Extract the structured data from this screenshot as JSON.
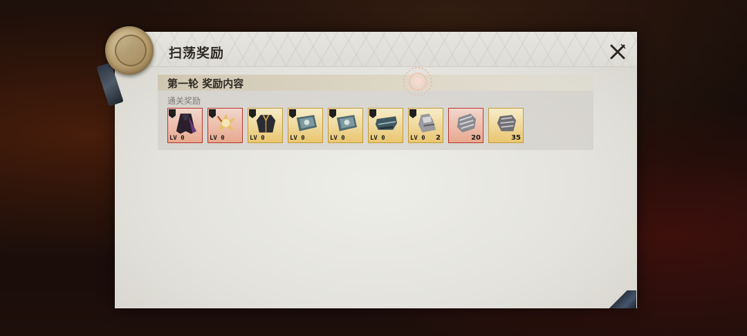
{
  "dialog": {
    "title": "扫荡奖励",
    "close_icon": "close-x-icon"
  },
  "round": {
    "title": "第一轮 奖励内容",
    "section_label": "通关奖励"
  },
  "rewards": [
    {
      "name": "dark-feather-cloak",
      "rarity": "red",
      "level_text": "LV 0",
      "qty": ""
    },
    {
      "name": "flame-crest-ornament",
      "rarity": "red",
      "level_text": "LV 0",
      "qty": ""
    },
    {
      "name": "dark-coat",
      "rarity": "gold",
      "level_text": "LV 0",
      "qty": ""
    },
    {
      "name": "teal-scroll",
      "rarity": "gold",
      "level_text": "LV 0",
      "qty": ""
    },
    {
      "name": "teal-scroll",
      "rarity": "gold",
      "level_text": "LV 0",
      "qty": ""
    },
    {
      "name": "teal-boots",
      "rarity": "gold",
      "level_text": "LV 0",
      "qty": ""
    },
    {
      "name": "silver-gauntlet",
      "rarity": "gold",
      "level_text": "LV 0",
      "qty": "2"
    },
    {
      "name": "metal-bracer",
      "rarity": "red",
      "level_text": "",
      "qty": "20"
    },
    {
      "name": "metal-bracer",
      "rarity": "gold",
      "level_text": "",
      "qty": "35"
    }
  ],
  "colors": {
    "red_frame": "#b7332b",
    "gold_frame": "#c29a39",
    "panel_bg": "#e6e5df"
  }
}
